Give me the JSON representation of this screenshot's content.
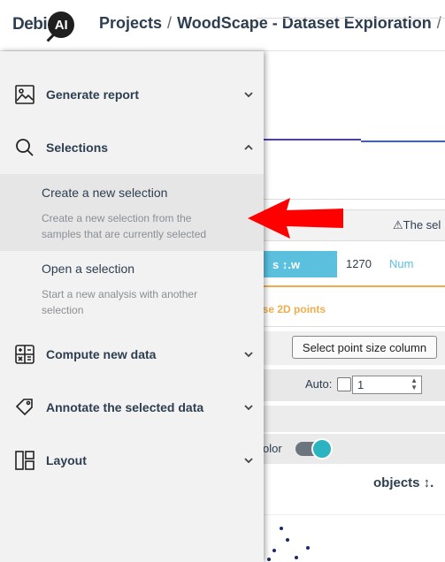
{
  "header": {
    "logo_text": "Debi",
    "logo_badge": "AI",
    "breadcrumb": [
      "Projects",
      "WoodScape - Dataset Exploration"
    ],
    "separator": "/"
  },
  "background": {
    "warning_text": "⚠The sel",
    "column": {
      "name": "s ↕.w",
      "value": "1270",
      "type": "Num"
    },
    "orange_text": "ase 2D points",
    "point_size_button": "Select point size column",
    "auto_label": "Auto:",
    "auto_value": "1",
    "color_label": "olor",
    "plot_title": "objects ↕.",
    "colors": {
      "accent": "#5bc0de",
      "warning": "#f0ad4e",
      "toggle": "#2bb3c0",
      "line": "#4b3bcb"
    }
  },
  "sidebar": {
    "items": [
      {
        "label": "Generate report",
        "icon": "image-report-icon",
        "expanded": false
      },
      {
        "label": "Selections",
        "icon": "search-icon",
        "expanded": true,
        "sub_items": [
          {
            "title": "Create a new selection",
            "description": "Create a new selection from the samples that are currently selected"
          },
          {
            "title": "Open a selection",
            "description": "Start a new analysis with another selection"
          }
        ]
      },
      {
        "label": "Compute new data",
        "icon": "calculator-icon",
        "expanded": false
      },
      {
        "label": "Annotate the selected data",
        "icon": "tag-icon",
        "expanded": false
      },
      {
        "label": "Layout",
        "icon": "layout-icon",
        "expanded": false
      }
    ]
  },
  "annotation": {
    "arrow_color": "#ff0000",
    "arrow_points_to": "create-new-selection-item"
  }
}
